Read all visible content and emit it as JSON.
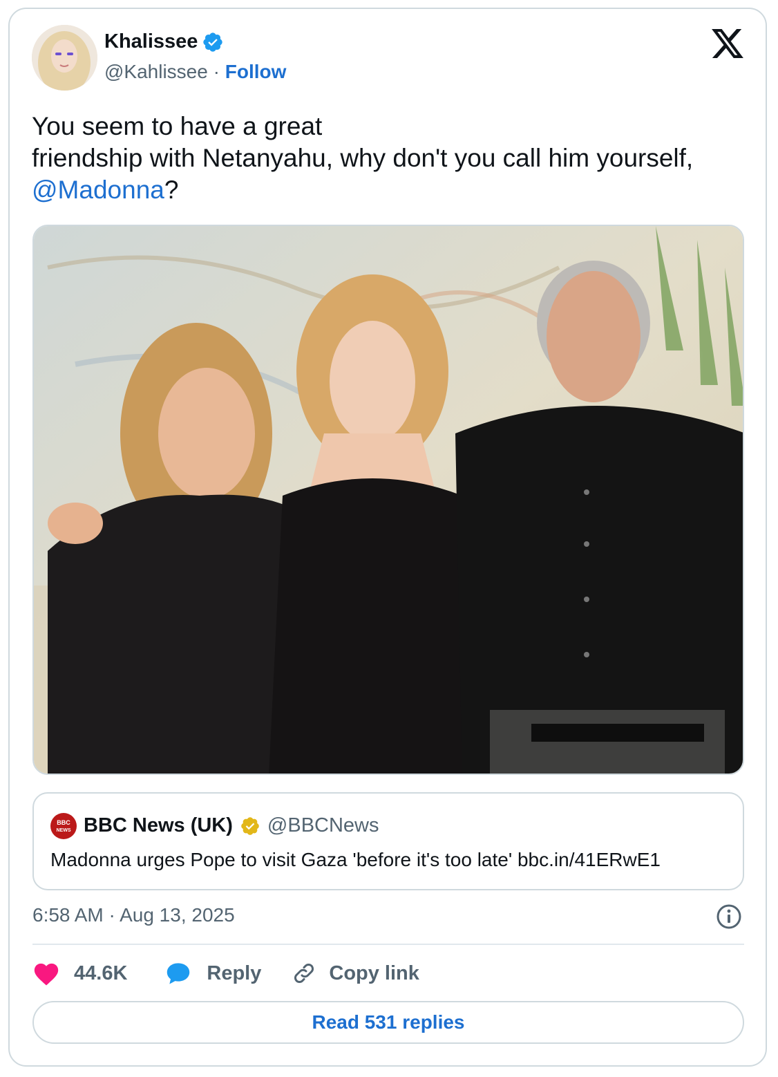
{
  "author": {
    "name": "Khalissee",
    "handle": "@Kahlissee",
    "separator": "·",
    "follow_label": "Follow"
  },
  "tweet": {
    "text_line1": "You seem to have a great",
    "text_line2": "friendship with Netanyahu, why don't you call him yourself,",
    "mention": "@Madonna",
    "text_end": "?"
  },
  "quoted_tweet": {
    "name": "BBC News (UK)",
    "handle": "@BBCNews",
    "text": "Madonna urges Pope to visit Gaza 'before it's too late' bbc.in/41ERwE1",
    "logo_text_top": "BBC",
    "logo_text_bottom": "NEWS"
  },
  "meta": {
    "timestamp": "6:58 AM · Aug 13, 2025"
  },
  "actions": {
    "likes": "44.6K",
    "reply_label": "Reply",
    "copy_label": "Copy link"
  },
  "read_replies_label": "Read 531 replies",
  "colors": {
    "link": "#1d6fd0",
    "verified": "#1d9bf0",
    "gold_verified": "#e2b719",
    "like": "#f91880",
    "reply": "#1d9bf0",
    "bbc_red": "#bb1919"
  },
  "icons": [
    "verified-badge-icon",
    "x-logo-icon",
    "gold-verified-badge-icon",
    "info-icon",
    "heart-icon",
    "reply-bubble-icon",
    "link-icon"
  ]
}
